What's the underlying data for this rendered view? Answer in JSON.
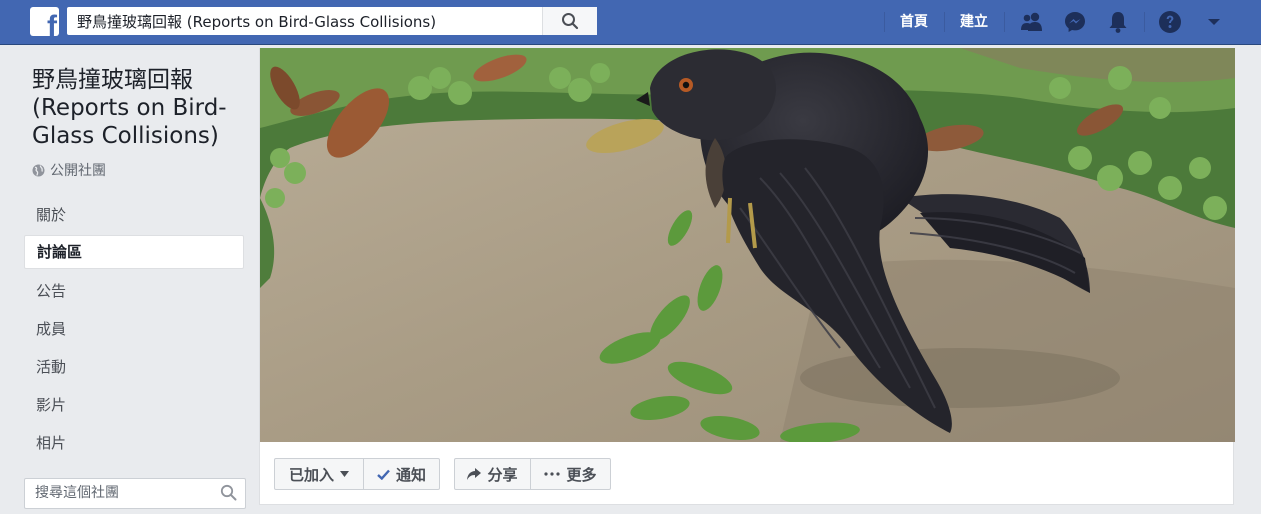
{
  "topbar": {
    "logo_letter": "f",
    "search_value": "野鳥撞玻璃回報 (Reports on Bird-Glass Collisions)",
    "home_label": "首頁",
    "create_label": "建立",
    "brand_color": "#4267b2"
  },
  "group": {
    "title": "野鳥撞玻璃回報 (Reports on Bird-Glass Collisions)",
    "privacy_label": "公開社團"
  },
  "sidebar": {
    "items": [
      {
        "label": "關於"
      },
      {
        "label": "討論區",
        "active": true
      },
      {
        "label": "公告"
      },
      {
        "label": "成員"
      },
      {
        "label": "活動"
      },
      {
        "label": "影片"
      },
      {
        "label": "相片"
      }
    ],
    "search_placeholder": "搜尋這個社團"
  },
  "actions": {
    "joined_label": "已加入",
    "notify_label": "通知",
    "share_label": "分享",
    "more_label": "更多"
  }
}
